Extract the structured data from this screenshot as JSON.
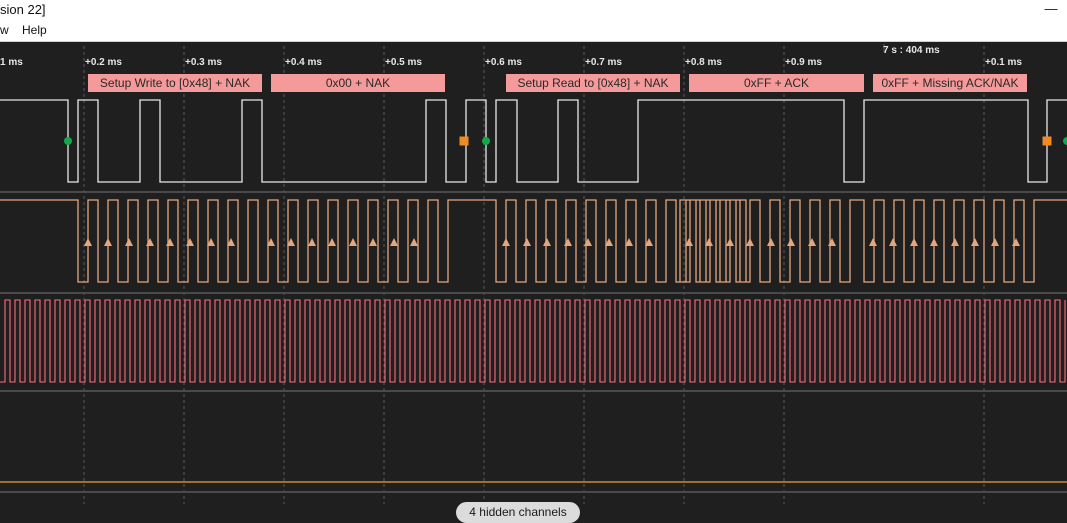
{
  "window": {
    "title": "sion 22]",
    "minimize_glyph": "—"
  },
  "menu": {
    "items": [
      "w",
      "Help"
    ]
  },
  "timeline": {
    "ticks": [
      "1 ms",
      "+0.2 ms",
      "+0.3 ms",
      "+0.4 ms",
      "+0.5 ms",
      "+0.6 ms",
      "+0.7 ms",
      "+0.8 ms",
      "+0.9 ms",
      "+0.1 ms"
    ],
    "marker_label": "7 s : 404 ms"
  },
  "annotations": [
    "Setup Write to [0x48] + NAK",
    "0x00 + NAK",
    "Setup Read to [0x48] + NAK",
    "0xFF + ACK",
    "0xFF + Missing ACK/NAK"
  ],
  "footer": {
    "hidden_channels_label": "4 hidden channels"
  },
  "colors": {
    "background": "#1f1f20",
    "channel0_trace": "#e8e8e8",
    "channel1_trace": "#e3a67e",
    "channel2_trace": "#ff6b7b",
    "channel3_trace": "#e8a13a",
    "annotation_fill": "#f49a9a",
    "start_marker": "#12a84c",
    "stop_marker": "#f08a24",
    "grid_line": "#5a5a5a",
    "channel_separator": "#4a4a4a"
  },
  "icons": {
    "start_marker": "green-circle-icon",
    "stop_marker": "orange-square-icon",
    "clock_edge": "rising-edge-arrow-icon"
  }
}
